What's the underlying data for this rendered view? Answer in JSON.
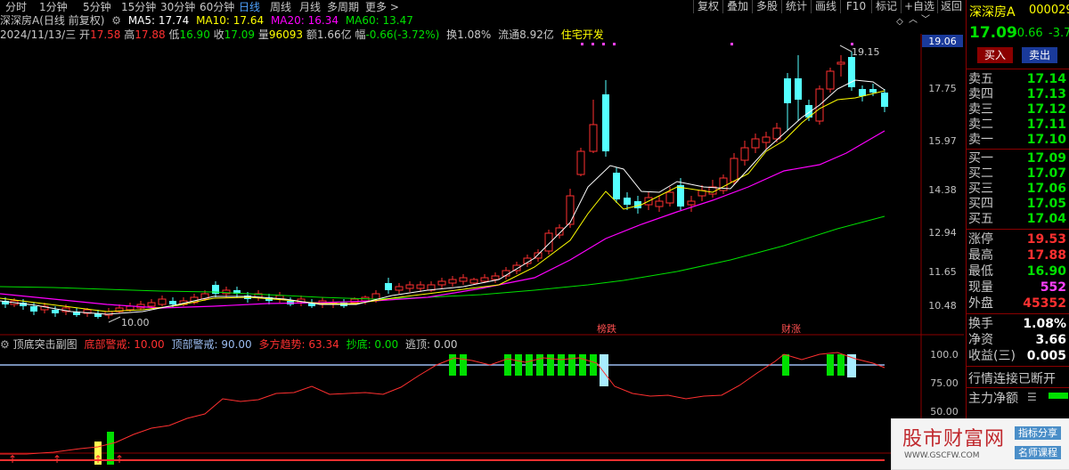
{
  "toolbar": {
    "periods": [
      "分时",
      "1分钟",
      "5分钟",
      "15分钟",
      "30分钟",
      "60分钟",
      "日线",
      "周线",
      "月线",
      "多周期",
      "更多 >"
    ],
    "active_period": "日线",
    "buttons": [
      "复权",
      "叠加",
      "多股",
      "统计",
      "画线",
      "F10",
      "标记",
      "+自选",
      "返回"
    ]
  },
  "stock": {
    "name": "深深房A",
    "mode": "(日线 前复权)",
    "ma5": "MA5: 17.74",
    "ma10": "MA10: 17.64",
    "ma20": "MA20: 16.34",
    "ma60": "MA60: 13.47",
    "date": "2024/11/13/三",
    "open_l": "开",
    "open": "17.58",
    "high_l": "高",
    "high": "17.88",
    "low_l": "低",
    "low": "16.90",
    "close_l": "收",
    "close": "17.09",
    "vol_l": "量",
    "vol": "96093",
    "amount": "额1.66亿",
    "change_l": "幅",
    "change": "-0.66(-3.72%)",
    "turnover": "换1.08%",
    "float": "流通8.92亿",
    "industry": "住宅开发"
  },
  "colors": {
    "up": "#ff3030",
    "down": "#54ffff",
    "ma5": "#ffffff",
    "ma10": "#ffff00",
    "ma20": "#ff00ff",
    "ma60": "#00e000",
    "label_blue": "#4fa3ff",
    "price_red": "#ff3030",
    "price_green": "#00e000"
  },
  "price_axis": {
    "ticks": [
      "19.06",
      "17.75",
      "15.97",
      "14.38",
      "12.94",
      "11.65",
      "10.48"
    ],
    "current_label": "19.06"
  },
  "annotations": {
    "high_mark": "19.15",
    "low_mark": "10.00",
    "event1": "榜跌",
    "event2": "财涨"
  },
  "indicator": {
    "name": "顶底突击副图",
    "bottom_warn": "底部警戒: 10.00",
    "top_warn": "顶部警戒: 90.00",
    "trend": "多方趋势: 63.34",
    "chaodi": "抄底: 0.00",
    "taoding": "逃顶: 0.00",
    "ticks": [
      "100.0",
      "75.00",
      "50.00"
    ]
  },
  "quote": {
    "name": "深深房A",
    "code": "000029",
    "price": "17.09",
    "change": "-0.66",
    "pct": "-3.7",
    "buy_btn": "买入",
    "sell_btn": "卖出",
    "asks": [
      {
        "label": "卖五",
        "price": "17.14"
      },
      {
        "label": "卖四",
        "price": "17.13"
      },
      {
        "label": "卖三",
        "price": "17.12"
      },
      {
        "label": "卖二",
        "price": "17.11"
      },
      {
        "label": "卖一",
        "price": "17.10"
      }
    ],
    "bids": [
      {
        "label": "买一",
        "price": "17.09"
      },
      {
        "label": "买二",
        "price": "17.07"
      },
      {
        "label": "买三",
        "price": "17.06"
      },
      {
        "label": "买四",
        "price": "17.05"
      },
      {
        "label": "买五",
        "price": "17.04"
      }
    ],
    "stats": [
      {
        "label": "涨停",
        "value": "19.53"
      },
      {
        "label": "最高",
        "value": "17.88"
      },
      {
        "label": "最低",
        "value": "16.90"
      },
      {
        "label": "现量",
        "value": "552"
      },
      {
        "label": "外盘",
        "value": "45352"
      }
    ],
    "fin": [
      {
        "label": "换手",
        "value": "1.08%"
      },
      {
        "label": "净资",
        "value": "3.66"
      },
      {
        "label": "收益(三)",
        "value": "0.005"
      }
    ],
    "status": "行情连接已断开",
    "net_flow": "主力净额"
  },
  "watermark": {
    "brand": "股市财富网",
    "url": "WWW.GSCFW.COM",
    "tag1": "指标分享",
    "tag2": "名师课程"
  }
}
